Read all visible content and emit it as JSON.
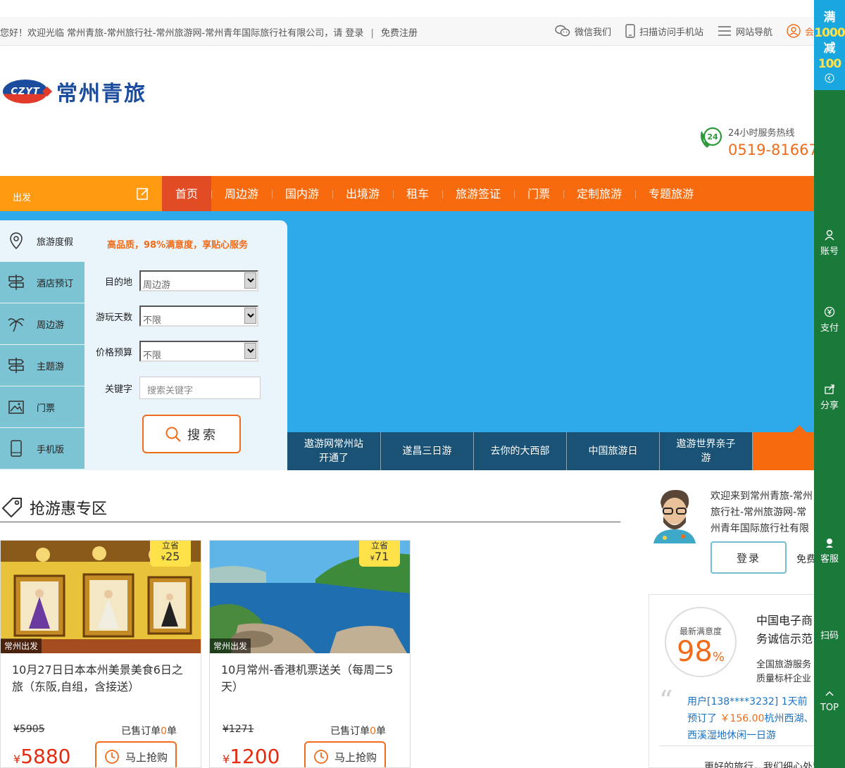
{
  "topbar": {
    "welcome": "您好！欢迎光临 常州青旅-常州旅行社-常州旅游网-常州青年国际旅行社有限公司，请",
    "login": "登录",
    "separator": "|",
    "register": "免费注册",
    "wechat": "微信我们",
    "mobile": "扫描访问手机站",
    "sitenav": "网站导航",
    "member": "会"
  },
  "logo": {
    "badge": "CZYT",
    "name": "常州青旅"
  },
  "hotline": {
    "label": "24小时服务热线",
    "number": "0519-81667",
    "icon_text": "24"
  },
  "nav": {
    "depart": "出发",
    "items": [
      "首页",
      "周边游",
      "国内游",
      "出境游",
      "租车",
      "旅游签证",
      "门票",
      "定制旅游",
      "专题旅游"
    ]
  },
  "search": {
    "tabs": [
      "旅游度假",
      "酒店预订",
      "周边游",
      "主题游",
      "门票",
      "手机版"
    ],
    "slogan": "高品质，98%满意度，享贴心服务",
    "destination_label": "目的地",
    "destination_value": "周边游",
    "days_label": "游玩天数",
    "days_value": "不限",
    "budget_label": "价格预算",
    "budget_value": "不限",
    "keyword_label": "关键字",
    "keyword_placeholder": "搜索关键字",
    "button": "搜索"
  },
  "hero_tabs": [
    {
      "line1": "遨游网常州站",
      "line2": "开通了"
    },
    {
      "line1": "遂昌三日游",
      "line2": ""
    },
    {
      "line1": "去你的大西部",
      "line2": ""
    },
    {
      "line1": "中国旅游日",
      "line2": ""
    },
    {
      "line1": "遨游世界亲子",
      "line2": "游"
    }
  ],
  "deals": {
    "title": "抢游惠专区",
    "save_label": "立省",
    "currency": "¥",
    "sold_prefix": "已售订单",
    "sold_suffix": "单",
    "buy_label": "马上抢购",
    "cards": [
      {
        "tag": "常州出发",
        "save": "25",
        "title": "10月27日日本本州美景美食6日之旅（东阪,自组，含接送）",
        "original": "¥5905",
        "sold": "0",
        "price": "5880"
      },
      {
        "tag": "常州出发",
        "save": "71",
        "title": "10月常州-香港机票送关（每周二5天）",
        "original": "¥1271",
        "sold": "0",
        "price": "1200"
      }
    ]
  },
  "right_panel": {
    "welcome": "欢迎来到常州青旅-常州旅行社-常州旅游网-常州青年国际旅行社有限公司！",
    "login": "登录",
    "register": "免费",
    "sat_label": "最新满意度",
    "sat_value": "98",
    "sat_unit": "%",
    "title": "中国电子商务诚信示范企业",
    "subtitle1": "全国旅游服务",
    "subtitle2": "质量标杆企业",
    "review_user": "用户[138****3232] 1天前预订了",
    "review_price": "￥156.00",
    "review_product": "杭州西湖、西溪湿地休闲一日游",
    "more": "更好的旅行，我们细心处置"
  },
  "sidebar": {
    "promo_a": "满",
    "promo_b": "1000",
    "promo_c": "减",
    "promo_d": "100",
    "account": "账号",
    "pay": "支付",
    "share": "分享",
    "service": "客服",
    "scan": "扫码",
    "top": "TOP"
  },
  "colors": {
    "orange": "#f76b0e",
    "blue": "#2ea9e9",
    "green": "#1a7a3a",
    "navy": "#1a5275"
  }
}
